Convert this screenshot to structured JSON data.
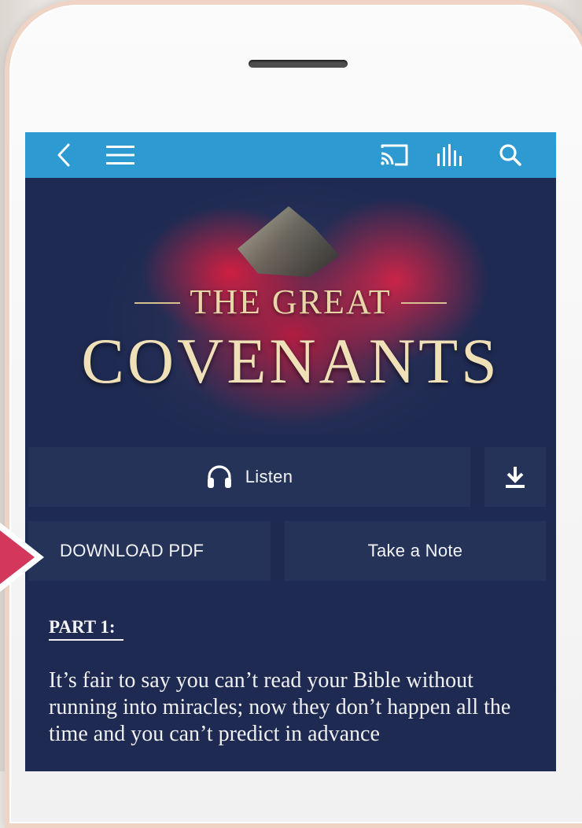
{
  "hero": {
    "line1": "THE GREAT",
    "line2": "COVENANTS"
  },
  "icons": {
    "back": "chevron-left-icon",
    "menu": "hamburger-icon",
    "cast": "cast-icon",
    "audio_levels": "equalizer-icon",
    "search": "search-icon",
    "headphones": "headphones-icon",
    "download": "download-icon"
  },
  "actions": {
    "listen_label": "Listen",
    "download_pdf_label": "DOWNLOAD PDF",
    "take_note_label": "Take a Note"
  },
  "content": {
    "part_title": "PART 1:",
    "body": "It’s fair to say you can’t read your Bible without running into miracles; now they don’t happen all the time and you can’t predict in advance"
  },
  "colors": {
    "topbar": "#2d9ad2",
    "screen_bg": "#1e2a52",
    "button_bg": "#263359",
    "pointer": "#d3385c"
  }
}
